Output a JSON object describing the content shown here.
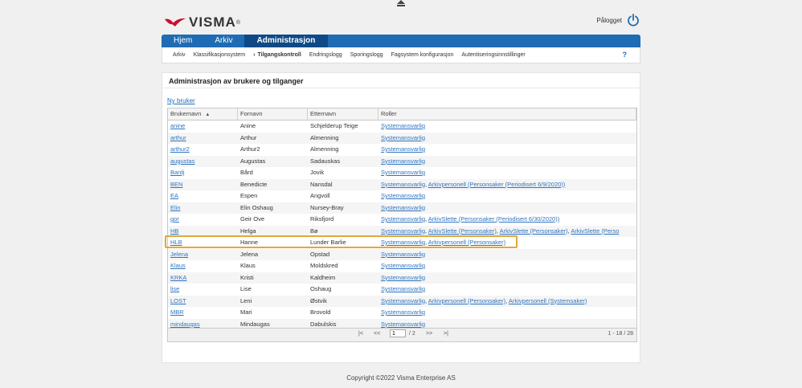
{
  "brand": {
    "name": "VISMA",
    "tm": "®",
    "colors": {
      "accent": "#1f6cb4",
      "logo": "#c8102e",
      "highlight": "#e3a73a"
    }
  },
  "login": {
    "label": "Pålogget",
    "icon": "power-icon"
  },
  "nav": {
    "tabs": [
      {
        "label": "Hjem",
        "active": false
      },
      {
        "label": "Arkiv",
        "active": false
      },
      {
        "label": "Administrasjon",
        "active": true
      }
    ]
  },
  "subnav": {
    "items": [
      "Arkiv",
      "Klassifikasjonsystem",
      "Tilgangskontroll",
      "Endringslogg",
      "Sporingslogg",
      "Fagsystem konfigurasjon",
      "Autentiseringsinnstillinger"
    ],
    "active_arrow": "›",
    "help": "?"
  },
  "page": {
    "title": "Administrasjon av brukere og tilganger",
    "new_user": "Ny bruker"
  },
  "table": {
    "headers": [
      "Brukernavn",
      "Fornavn",
      "Etternavn",
      "Roller"
    ],
    "sort_indicator": "▲",
    "rows": [
      {
        "user": "anine",
        "first": "Anine",
        "last": "Schjelderup Teige",
        "roles": [
          "Systemansvarlig"
        ]
      },
      {
        "user": "arthur",
        "first": "Arthur",
        "last": "Almenning",
        "roles": [
          "Systemansvarlig"
        ]
      },
      {
        "user": "arthur2",
        "first": "Arthur2",
        "last": "Almenning",
        "roles": [
          "Systemansvarlig"
        ]
      },
      {
        "user": "augustas",
        "first": "Augustas",
        "last": "Sadauskas",
        "roles": [
          "Systemansvarlig"
        ]
      },
      {
        "user": "Bardj",
        "first": "Bård",
        "last": "Jovik",
        "roles": [
          "Systemansvarlig"
        ]
      },
      {
        "user": "BEN",
        "first": "Benedicte",
        "last": "Nansdal",
        "roles": [
          "Systemansvarlig",
          "Arkivpersonell (Personsaker (Periodisert 6/9/2020))"
        ]
      },
      {
        "user": "EA",
        "first": "Espen",
        "last": "Angvoll",
        "roles": [
          "Systemansvarlig"
        ]
      },
      {
        "user": "Elin",
        "first": "Elin Oshaug",
        "last": "Nursey-Bray",
        "roles": [
          "Systemansvarlig"
        ]
      },
      {
        "user": "gor",
        "first": "Geir Ove",
        "last": "Riksfjord",
        "roles": [
          "Systemansvarlig",
          "ArkivSlette (Personsaker (Periodisert 6/30/2020))"
        ]
      },
      {
        "user": "HB",
        "first": "Helga",
        "last": "Bø",
        "roles": [
          "Systemansvarlig",
          "ArkivSlette (Personsaker)",
          "ArkivSlette (Personsaker)",
          "ArkivSlette (Perso"
        ]
      },
      {
        "user": "HLB",
        "first": "Hanne",
        "last": "Lunder Barlie",
        "roles": [
          "Systemansvarlig",
          "Arkivpersonell (Personsaker)"
        ]
      },
      {
        "user": "Jelena",
        "first": "Jelena",
        "last": "Opstad",
        "roles": [
          "Systemansvarlig"
        ]
      },
      {
        "user": "Klaus",
        "first": "Klaus",
        "last": "Moldskred",
        "roles": [
          "Systemansvarlig"
        ]
      },
      {
        "user": "KRKA",
        "first": "Kristi",
        "last": "Kaldheim",
        "roles": [
          "Systemansvarlig"
        ]
      },
      {
        "user": "lise",
        "first": "Lise",
        "last": "Oshaug",
        "roles": [
          "Systemansvarlig"
        ]
      },
      {
        "user": "LOST",
        "first": "Leni",
        "last": "Østvik",
        "roles": [
          "Systemansvarlig",
          "Arkivpersonell (Personsaker)",
          "Arkivpersonell (Systemsaker)"
        ]
      },
      {
        "user": "MBR",
        "first": "Mari",
        "last": "Brovold",
        "roles": [
          "Systemansvarlig"
        ]
      },
      {
        "user": "mindaugas",
        "first": "Mindaugas",
        "last": "Dabulskis",
        "roles": [
          "Systemansvarlig"
        ]
      }
    ]
  },
  "pager": {
    "first": "|<",
    "prev": "<<",
    "page": "1",
    "of": "/ 2",
    "next": ">>",
    "last": ">|",
    "range": "1 - 18 / 28"
  },
  "footer": {
    "copyright": "Copyright ©2022 Visma Enterprise AS"
  }
}
